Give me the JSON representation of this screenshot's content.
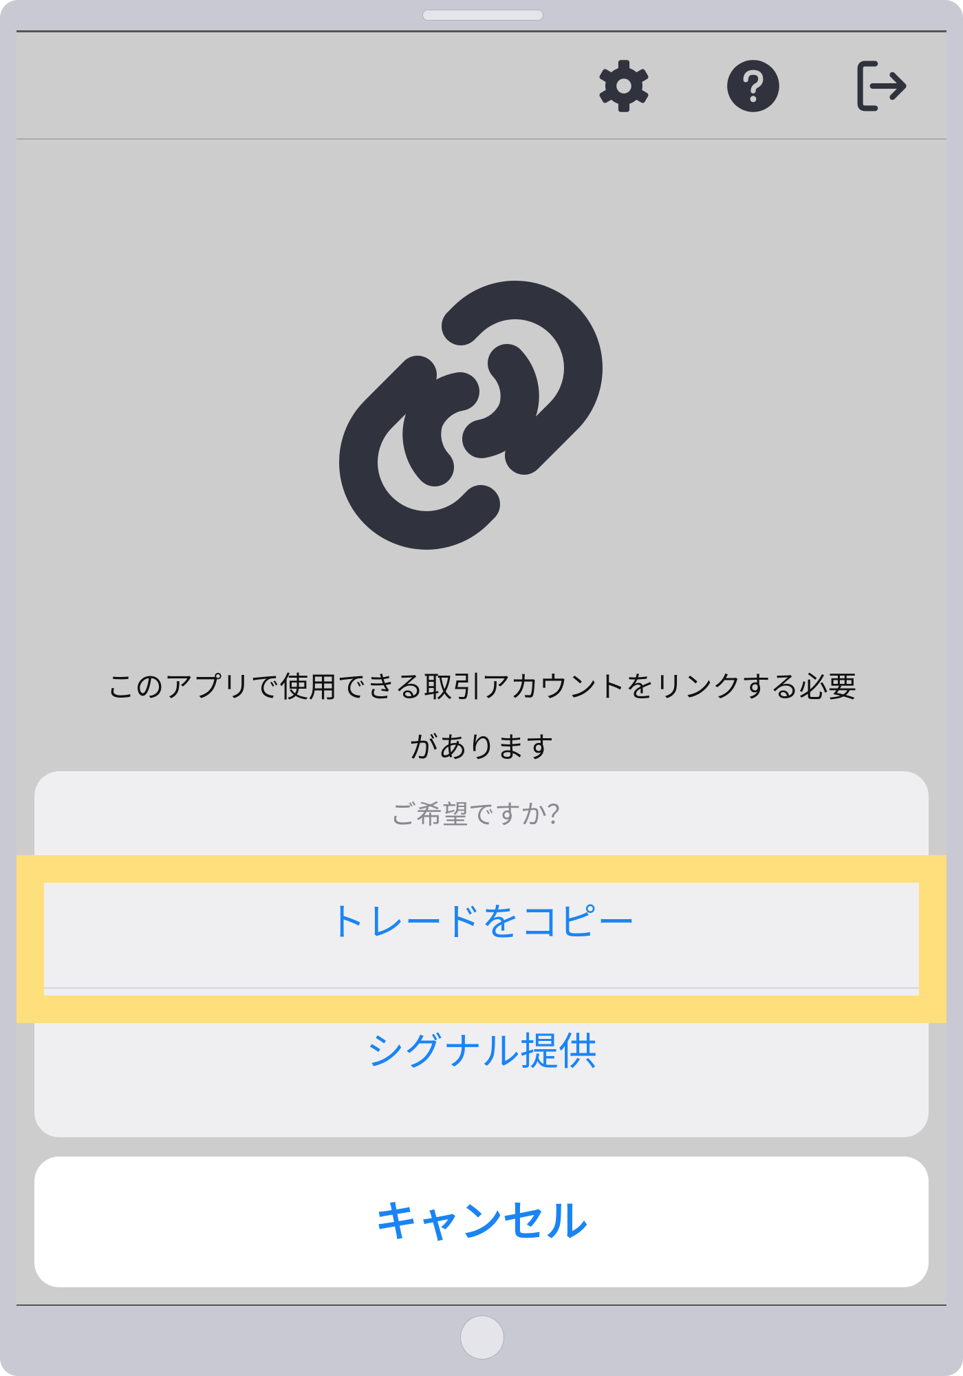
{
  "toolbar": {
    "icons": [
      "gear-icon",
      "help-icon",
      "logout-icon"
    ]
  },
  "hero": {
    "icon": "link-icon",
    "message_line1": "このアプリで使用できる取引アカウントをリンクする必要",
    "message_line2": "があります"
  },
  "action_sheet": {
    "title": "ご希望ですか？",
    "options": [
      "トレードをコピー",
      "シグナル提供"
    ],
    "cancel_label": "キャンセル",
    "highlighted_option": "トレードをコピー"
  },
  "colors": {
    "accent": "#1a84f5",
    "icon": "#30333d",
    "highlight": "#ffde7c",
    "screen_bg": "#cdcdcd",
    "frame": "#c9c9d4"
  }
}
